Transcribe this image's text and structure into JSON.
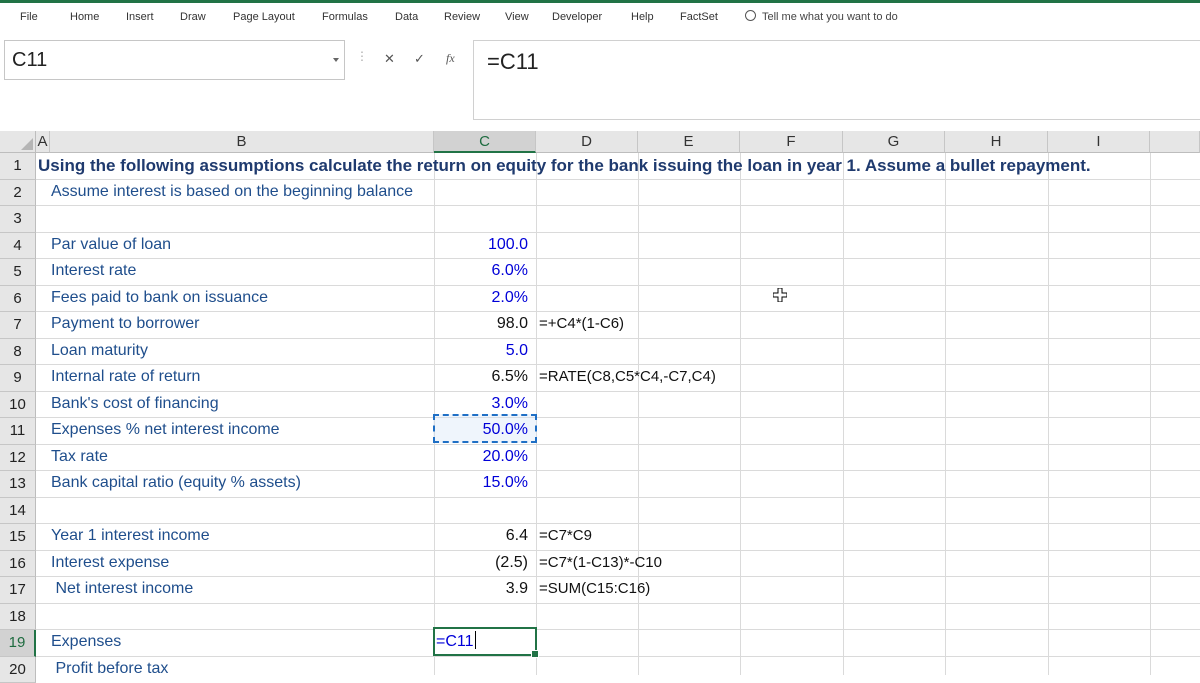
{
  "ribbon": {
    "tabs": [
      "File",
      "Home",
      "Insert",
      "Draw",
      "Page Layout",
      "Formulas",
      "Data",
      "Review",
      "View",
      "Developer",
      "Help",
      "FactSet"
    ],
    "tell_me": "Tell me what you want to do"
  },
  "formula_bar": {
    "name_box": "C11",
    "cancel": "✕",
    "enter": "✓",
    "fx": "fx",
    "formula": "=C11"
  },
  "columns": [
    "A",
    "B",
    "C",
    "D",
    "E",
    "F",
    "G",
    "H",
    "I"
  ],
  "selected_column": "C",
  "rows": [
    "1",
    "2",
    "3",
    "4",
    "5",
    "6",
    "7",
    "8",
    "9",
    "10",
    "11",
    "12",
    "13",
    "14",
    "15",
    "16",
    "17",
    "18",
    "19",
    "20"
  ],
  "selected_row": "19",
  "sheet": {
    "title": "Using the following assumptions calculate the return on equity for the bank issuing the loan in year 1. Assume a bullet repayment.",
    "subtitle": "Assume interest is based on the beginning balance",
    "rows": [
      {
        "row": 4,
        "label": "Par value of loan",
        "value": "100.0",
        "input": true,
        "formula": ""
      },
      {
        "row": 5,
        "label": "Interest rate",
        "value": "6.0%",
        "input": true,
        "formula": ""
      },
      {
        "row": 6,
        "label": "Fees paid to bank on issuance",
        "value": "2.0%",
        "input": true,
        "formula": ""
      },
      {
        "row": 7,
        "label": "Payment to borrower",
        "value": "98.0",
        "input": false,
        "formula": "=+C4*(1-C6)"
      },
      {
        "row": 8,
        "label": "Loan maturity",
        "value": "5.0",
        "input": true,
        "formula": ""
      },
      {
        "row": 9,
        "label": "Internal rate of return",
        "value": "6.5%",
        "input": false,
        "formula": "=RATE(C8,C5*C4,-C7,C4)"
      },
      {
        "row": 10,
        "label": "Bank's cost of financing",
        "value": "3.0%",
        "input": true,
        "formula": ""
      },
      {
        "row": 11,
        "label": "Expenses % net interest income",
        "value": "50.0%",
        "input": true,
        "formula": ""
      },
      {
        "row": 12,
        "label": "Tax rate",
        "value": "20.0%",
        "input": true,
        "formula": ""
      },
      {
        "row": 13,
        "label": "Bank capital ratio (equity % assets)",
        "value": "15.0%",
        "input": true,
        "formula": ""
      },
      {
        "row": 15,
        "label": "Year 1 interest income",
        "value": "6.4",
        "input": false,
        "formula": "=C7*C9"
      },
      {
        "row": 16,
        "label": "Interest expense",
        "value": "(2.5)",
        "input": false,
        "formula": "=C7*(1-C13)*-C10"
      },
      {
        "row": 17,
        "label": " Net interest income",
        "value": "3.9",
        "input": false,
        "formula": "=SUM(C15:C16)"
      },
      {
        "row": 19,
        "label": "Expenses",
        "value": "",
        "input": false,
        "formula": ""
      },
      {
        "row": 20,
        "label": " Profit before tax",
        "value": "",
        "input": false,
        "formula": ""
      }
    ],
    "editing_cell": {
      "ref": "C19",
      "text": "=C11"
    }
  }
}
